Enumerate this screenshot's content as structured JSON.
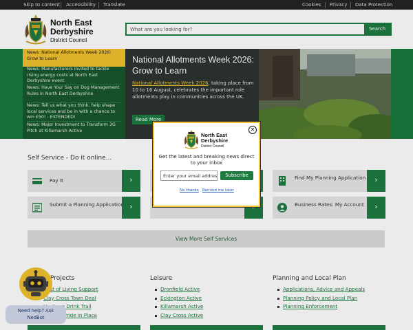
{
  "topbar": {
    "left": [
      "Skip to content",
      "Accessibility",
      "Translate"
    ],
    "right": [
      "Cookies",
      "Privacy",
      "Data Protection"
    ]
  },
  "header": {
    "logo_name_line1": "North East",
    "logo_name_line2": "Derbyshire",
    "logo_sub": "District Council",
    "search_placeholder": "What are you looking for?",
    "search_button": "Search"
  },
  "news": [
    "News: National Allotments Week 2026: Grow to Learn",
    "News: Manufacturers invited to tackle rising energy costs at North East Derbyshire event",
    "News: Have Your Say on Dog Management Rules in North East Derbyshire",
    "News: Tell us what you think, help shape local services and be in with a chance to win £50! - EXTENDED!",
    "News: Major Investment to Transform 3G Pitch at Killamarsh Active"
  ],
  "feature": {
    "title": "National Allotments Week 2026: Grow to Learn",
    "body_link": "National Allotments Week 2026",
    "body_rest": ", taking place from 10 to 16 August, celebrates the important role allotments play in communities across the UK.",
    "more": "Read More"
  },
  "self_service": {
    "title": "Self Service - Do it online...",
    "tiles": [
      {
        "label": "Pay It",
        "icon": "credit-card-icon"
      },
      {
        "label": "",
        "icon": ""
      },
      {
        "label": "Find My Planning Application",
        "icon": "building-icon"
      },
      {
        "label": "Submit a Planning Application",
        "icon": "form-icon"
      },
      {
        "label": "",
        "icon": ""
      },
      {
        "label": "Business Rates: My Account",
        "icon": "user-icon"
      }
    ],
    "arrow": "›",
    "view_more": "View More Self Services"
  },
  "columns": [
    {
      "heading": "Projects",
      "links": [
        "Cost of Living Support",
        "Clay Cross Town Deal",
        "Heritage Drink Trail",
        "Town of Pride in Place"
      ]
    },
    {
      "heading": "Leisure",
      "links": [
        "Dronfield Active",
        "Eckington Active",
        "Killamarsh Active",
        "Clay Cross Active"
      ]
    },
    {
      "heading": "Planning and Local Plan",
      "links": [
        "Applications, Advice and Appeals",
        "Planning Policy and Local Plan",
        "Planning Enforcement"
      ]
    }
  ],
  "chatbot": {
    "line1": "Need help? Ask",
    "line2": "NedBot",
    "icon": "robot-icon"
  },
  "modal": {
    "close": "✕",
    "logo_name_line1": "North East",
    "logo_name_line2": "Derbyshire",
    "logo_sub": "District Council",
    "message": "Get the latest and breaking news direct to your inbox",
    "email_placeholder": "Enter your email address",
    "subscribe": "Subscribe",
    "no_thanks": "No thanks",
    "remind_later": "Remind me later"
  },
  "colors": {
    "brand_green": "#1e7b40",
    "dark_green": "#17572c",
    "accent_yellow": "#f2c230"
  }
}
